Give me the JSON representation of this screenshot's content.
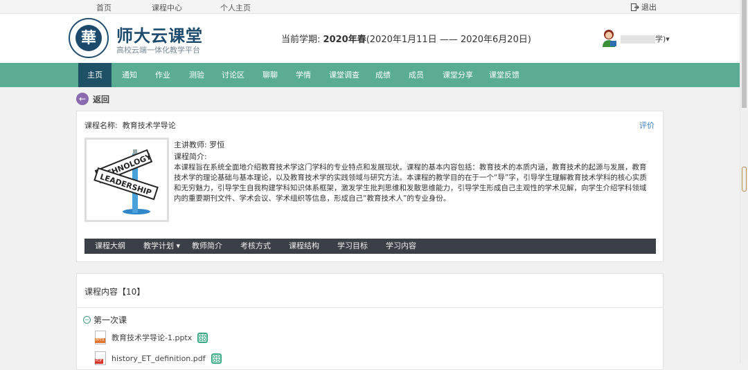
{
  "topbar": {
    "links": [
      "首页",
      "课程中心",
      "个人主页"
    ],
    "logout": "退出"
  },
  "header": {
    "site_title": "师大云课堂",
    "site_subtitle": "高校云端一体化教学平台",
    "logo_char": "華",
    "term_label": "当前学期:",
    "term_value": "2020年春",
    "term_range": "(2020年1月11日 —— 2020年6月20日)",
    "user_suffix": "学)"
  },
  "nav": {
    "items": [
      "主页",
      "通知",
      "作业",
      "测验",
      "讨论区",
      "聊聊",
      "学情",
      "课堂调查",
      "成绩",
      "成员",
      "课堂分享",
      "课堂反馈"
    ],
    "active_index": 0
  },
  "back": "返回",
  "course": {
    "name_label": "课程名称:",
    "name": "教育技术学导论",
    "rate": "评价",
    "teacher_label": "主讲教师:",
    "teacher": "罗恒",
    "intro_label": "课程简介:",
    "intro": "本课程旨在系统全面地介绍教育技术学这门学科的专业特点和发展现状。课程的基本内容包括：教育技术的本质内涵，教育技术的起源与发展，教育技术学的理论基础与基本理论，以及教育技术学的实践领域与研究方法。本课程的教学目的在于一个“导”字，引导学生理解教育技术学科的核心实质和无穷魅力，引导学生自我构建学科知识体系框架，激发学生批判思维和发散思维能力，引导学生形成自己主观性的学术见解，向学生介绍学科领域内的重要期刊文件、学术会议、学术组织等信息，形成自己“教育技术人”的专业身份。",
    "image_sign_top": "TECHNOLOGY",
    "image_sign_bottom": "LEADERSHIP"
  },
  "subnav": {
    "items": [
      "课程大纲",
      "教学计划",
      "教师简介",
      "考核方式",
      "课程结构",
      "学习目标",
      "学习内容"
    ]
  },
  "content": {
    "title": "课程内容【10】",
    "lesson": "第一次课",
    "files": [
      {
        "name": "教育技术学导论-1.pptx",
        "type": "PPTX"
      },
      {
        "name": "history_ET_definition.pdf",
        "type": "PDF"
      }
    ]
  },
  "colors": {
    "nav_bg": "#5aac93",
    "nav_active": "#1e5066",
    "brand": "#1b4a6d",
    "subnav_bg": "#3b3f47",
    "link": "#3a7bbf"
  }
}
